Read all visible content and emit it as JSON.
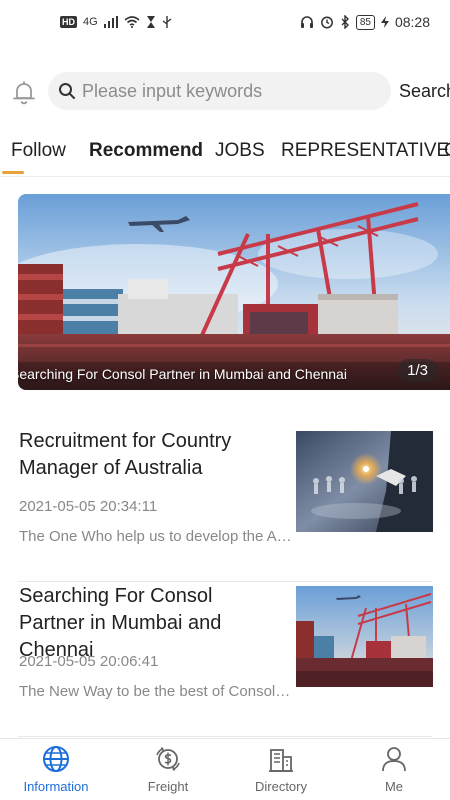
{
  "status_bar": {
    "hd_label": "HD",
    "network_label": "4G",
    "battery": "85",
    "time": "08:28"
  },
  "search": {
    "placeholder": "Please input keywords",
    "button_label": "Search"
  },
  "tabs": [
    {
      "label": "Follow"
    },
    {
      "label": "Recommend"
    },
    {
      "label": "JOBS"
    },
    {
      "label": "REPRESENTATIVE"
    },
    {
      "label": "C"
    }
  ],
  "banner": {
    "caption": "Searching For Consol Partner in Mumbai and Chennai",
    "pager": "1/3"
  },
  "news": [
    {
      "title": "Recruitment for Country Manager of Australia",
      "date": "2021-05-05 20:34:11",
      "description": "The One Who help us to develop the Australian market"
    },
    {
      "title": "Searching For Consol Partner in Mumbai and Chennai",
      "date": "2021-05-05 20:06:41",
      "description": "The New Way to be the best of Consol Partner"
    }
  ],
  "bottom_nav": [
    {
      "label": "Information",
      "icon": "globe-icon",
      "active": true
    },
    {
      "label": "Freight",
      "icon": "freight-icon",
      "active": false
    },
    {
      "label": "Directory",
      "icon": "directory-icon",
      "active": false
    },
    {
      "label": "Me",
      "icon": "person-icon",
      "active": false
    }
  ],
  "colors": {
    "accent_tab": "#e8a23a",
    "nav_active": "#1e6fd9",
    "text_secondary": "#888888"
  }
}
